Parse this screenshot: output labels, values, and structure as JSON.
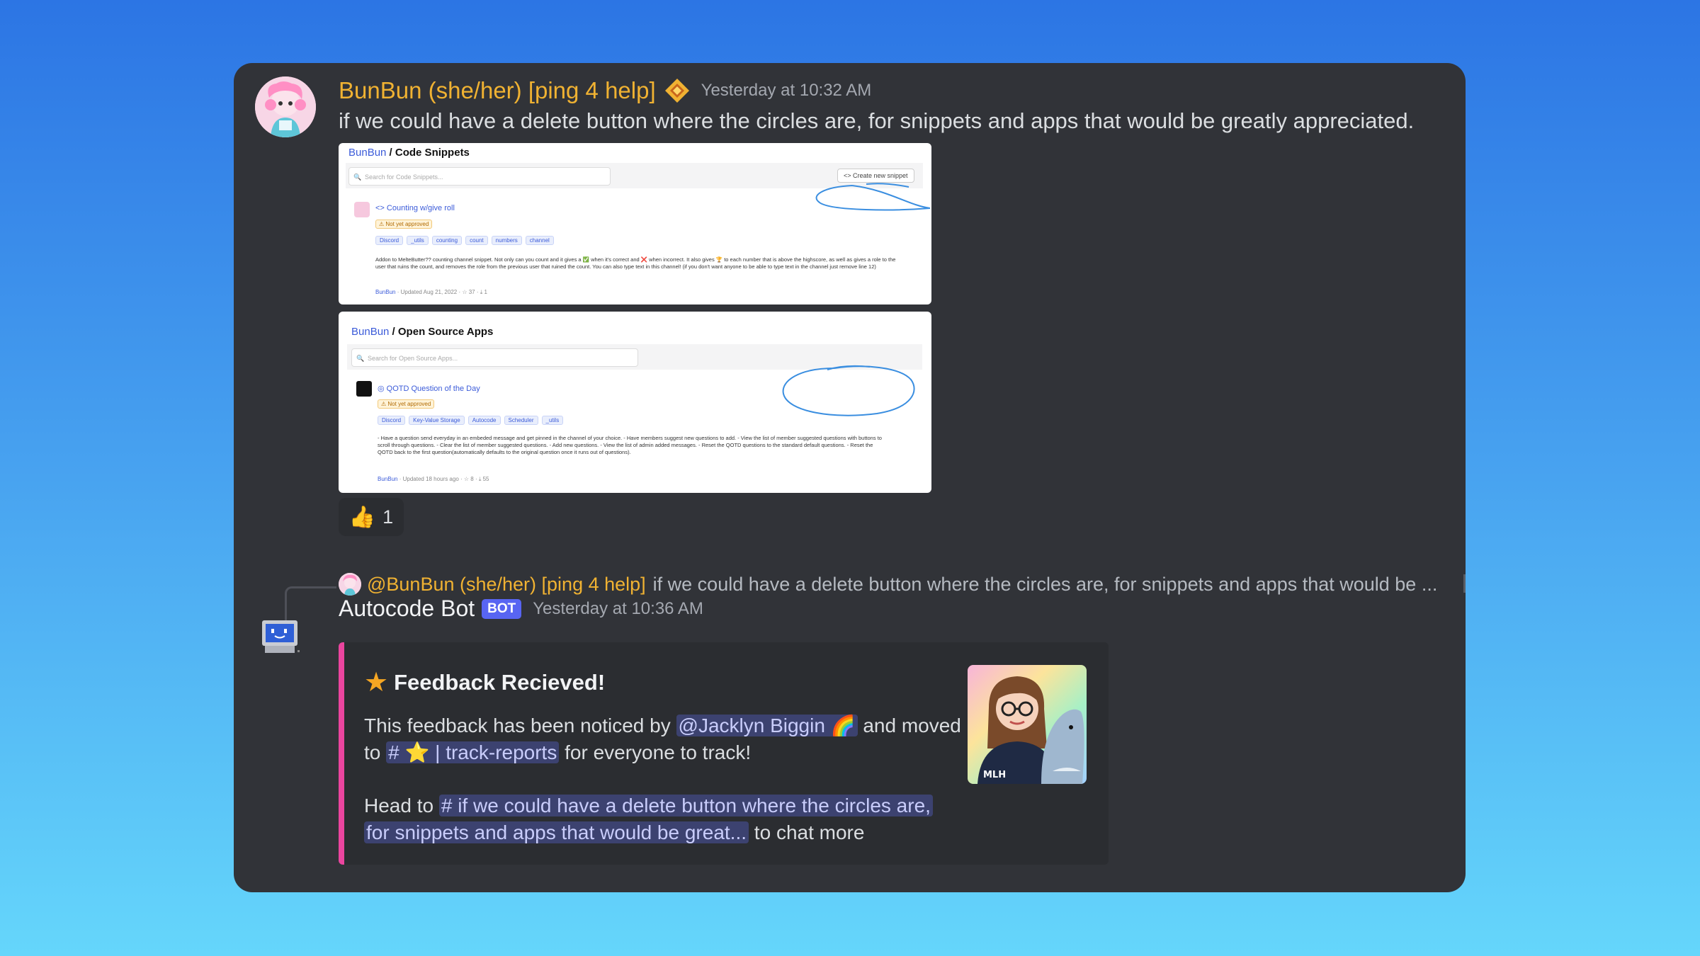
{
  "message1": {
    "author": "BunBun (she/her) [ping 4 help]",
    "timestamp": "Yesterday at 10:32 AM",
    "role_icon": "gold-diamond-badge-icon",
    "text": "if we could have a delete button where the circles are, for snippets and apps that would be greatly appreciated.",
    "attachment1": {
      "crumb": "BunBun",
      "title": " / Code Snippets",
      "search_placeholder": "Search for Code Snippets...",
      "create_button": "Create new snippet",
      "item_title": "Counting w/give roll",
      "status": "Not yet approved",
      "tags": [
        "Discord",
        "_utils",
        "counting",
        "count",
        "numbers",
        "channel"
      ],
      "description": "Addon to MelteButter?? counting channel snippet. Not only can you count and it gives a ✅ when it's correct and ❌ when incorrect. It also gives 🏆 to each number that is above the highscore, as well as gives a role to the user that ruins the count, and removes the role from the previous user that ruined the count. You can also type text in this channel! (if you don't want anyone to be able to type text in the channel just remove line 12)",
      "meta_author": "BunBun",
      "meta_updated": "· Updated Aug 21, 2022 · ☆ 37 · ⤓ 1"
    },
    "attachment2": {
      "crumb": "BunBun",
      "title": " / Open Source Apps",
      "search_placeholder": "Search for Open Source Apps...",
      "item_title": "QOTD Question of the Day",
      "status": "Not yet approved",
      "tags": [
        "Discord",
        "Key-Value Storage",
        "Autocode",
        "Scheduler",
        "_utils"
      ],
      "description": "- Have a question send everyday in an embeded message and get pinned in the channel of your choice. - Have members suggest new questions to add. - View the list of member suggested questions with buttons to scroll through questions. - Clear the list of member suggested questions. - Add new questions. - View the list of admin added messages. - Reset the QOTD questions to the standard default questions. - Reset the QOTD back to the first question(automatically defaults to the original question once it runs out of questions).",
      "meta_author": "BunBun",
      "meta_updated": "· Updated 18 hours ago · ☆ 8 · ⤓ 55"
    },
    "reaction": {
      "emoji": "👍",
      "count": "1"
    }
  },
  "message2": {
    "reply": {
      "author": "@BunBun (she/her) [ping 4 help]",
      "text": "if we could have a delete button where the circles are, for snippets and apps that would be ..."
    },
    "author": "Autocode Bot",
    "bot_tag": "BOT",
    "timestamp": "Yesterday at 10:36 AM",
    "embed": {
      "title_icon": "★",
      "title": "Feedback Recieved!",
      "line1_pre": "This feedback has been noticed by ",
      "user_mention": "@Jacklyn Biggin 🌈",
      "line1_post": " and moved",
      "line2_pre": "to ",
      "channel_mention": "# ⭐ | track-reports",
      "line2_post": " for everyone to track!",
      "line3_pre": "Head to ",
      "thread_mention_1": "# if we could have a delete button where the circles are,",
      "thread_mention_2": "for snippets and apps that would be great...",
      "line4_post": " to chat more",
      "thumbnail_label": "MLH"
    }
  },
  "colors": {
    "background_top": "#2c75e4",
    "background_bottom": "#65d6fb",
    "window": "#313338",
    "username_gold": "#f0b232",
    "embed_accent": "#eb459f",
    "mention_bg": "#3c4270",
    "bot_tag": "#5865f2",
    "annotation_circle": "#3a8ee0"
  }
}
